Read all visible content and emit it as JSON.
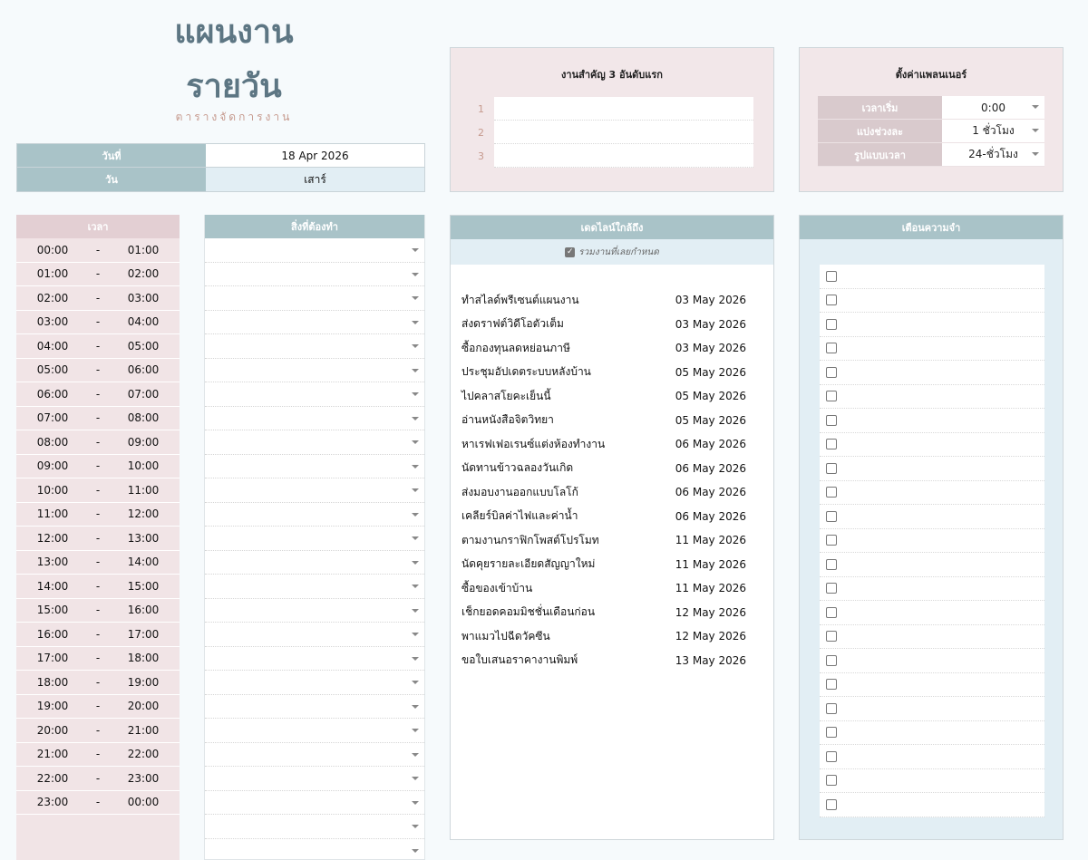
{
  "title": {
    "line1": "แผนงาน",
    "line2": "รายวัน",
    "subtitle": "ตารางจัดการงาน"
  },
  "date_info": {
    "date_label": "วันที่",
    "date_value": "18 Apr 2026",
    "day_label": "วัน",
    "day_value": "เสาร์"
  },
  "priority": {
    "title": "งานสำคัญ 3 อันดับแรก",
    "numbers": [
      "1",
      "2",
      "3"
    ]
  },
  "settings": {
    "title": "ตั้งค่าแพลนเนอร์",
    "rows": [
      {
        "label": "เวลาเริ่ม",
        "value": "0:00"
      },
      {
        "label": "แบ่งช่วงละ",
        "value": "1 ชั่วโมง"
      },
      {
        "label": "รูปแบบเวลา",
        "value": "24-ชั่วโมง"
      }
    ]
  },
  "time_column": {
    "header": "เวลา",
    "dash": "-",
    "slots": [
      [
        "00:00",
        "01:00"
      ],
      [
        "01:00",
        "02:00"
      ],
      [
        "02:00",
        "03:00"
      ],
      [
        "03:00",
        "04:00"
      ],
      [
        "04:00",
        "05:00"
      ],
      [
        "05:00",
        "06:00"
      ],
      [
        "06:00",
        "07:00"
      ],
      [
        "07:00",
        "08:00"
      ],
      [
        "08:00",
        "09:00"
      ],
      [
        "09:00",
        "10:00"
      ],
      [
        "10:00",
        "11:00"
      ],
      [
        "11:00",
        "12:00"
      ],
      [
        "12:00",
        "13:00"
      ],
      [
        "13:00",
        "14:00"
      ],
      [
        "14:00",
        "15:00"
      ],
      [
        "15:00",
        "16:00"
      ],
      [
        "16:00",
        "17:00"
      ],
      [
        "17:00",
        "18:00"
      ],
      [
        "18:00",
        "19:00"
      ],
      [
        "19:00",
        "20:00"
      ],
      [
        "20:00",
        "21:00"
      ],
      [
        "21:00",
        "22:00"
      ],
      [
        "22:00",
        "23:00"
      ],
      [
        "23:00",
        "00:00"
      ]
    ]
  },
  "todo_column": {
    "header": "สิ่งที่ต้องทำ"
  },
  "deadlines": {
    "header": "เดดไลน์ใกล้ถึง",
    "include_overdue_label": "รวมงานที่เลยกำหนด",
    "include_overdue_checked": true,
    "items": [
      {
        "task": "ทำสไลด์พรีเซนต์แผนงาน",
        "date": "03 May 2026"
      },
      {
        "task": "ส่งดราฟต์วิดีโอตัวเต็ม",
        "date": "03 May 2026"
      },
      {
        "task": "ซื้อกองทุนลดหย่อนภาษี",
        "date": "03 May 2026"
      },
      {
        "task": "ประชุมอัปเดตระบบหลังบ้าน",
        "date": "05 May 2026"
      },
      {
        "task": "ไปคลาสโยคะเย็นนี้",
        "date": "05 May 2026"
      },
      {
        "task": "อ่านหนังสือจิตวิทยา",
        "date": "05 May 2026"
      },
      {
        "task": "หาเรฟเฟอเรนซ์แต่งห้องทำงาน",
        "date": "06 May 2026"
      },
      {
        "task": "นัดทานข้าวฉลองวันเกิด",
        "date": "06 May 2026"
      },
      {
        "task": "ส่งมอบงานออกแบบโลโก้",
        "date": "06 May 2026"
      },
      {
        "task": "เคลียร์บิลค่าไฟและค่าน้ำ",
        "date": "06 May 2026"
      },
      {
        "task": "ตามงานกราฟิกโพสต์โปรโมท",
        "date": "11 May 2026"
      },
      {
        "task": "นัดคุยรายละเอียดสัญญาใหม่",
        "date": "11 May 2026"
      },
      {
        "task": "ซื้อของเข้าบ้าน",
        "date": "11 May 2026"
      },
      {
        "task": "เช็กยอดคอมมิชชั่นเดือนก่อน",
        "date": "12 May 2026"
      },
      {
        "task": "พาแมวไปฉีดวัคซีน",
        "date": "12 May 2026"
      },
      {
        "task": "ขอใบเสนอราคางานพิมพ์",
        "date": "13 May 2026"
      }
    ]
  },
  "reminders": {
    "header": "เตือนความจำ"
  },
  "colors": {
    "title": "#5d7683",
    "subtitle": "#c69a8e",
    "teal_header": "#a9c3c8",
    "pink_header": "#e3cfd3",
    "pink_bg": "#f2e7e9",
    "light_blue": "#e2eef4"
  }
}
